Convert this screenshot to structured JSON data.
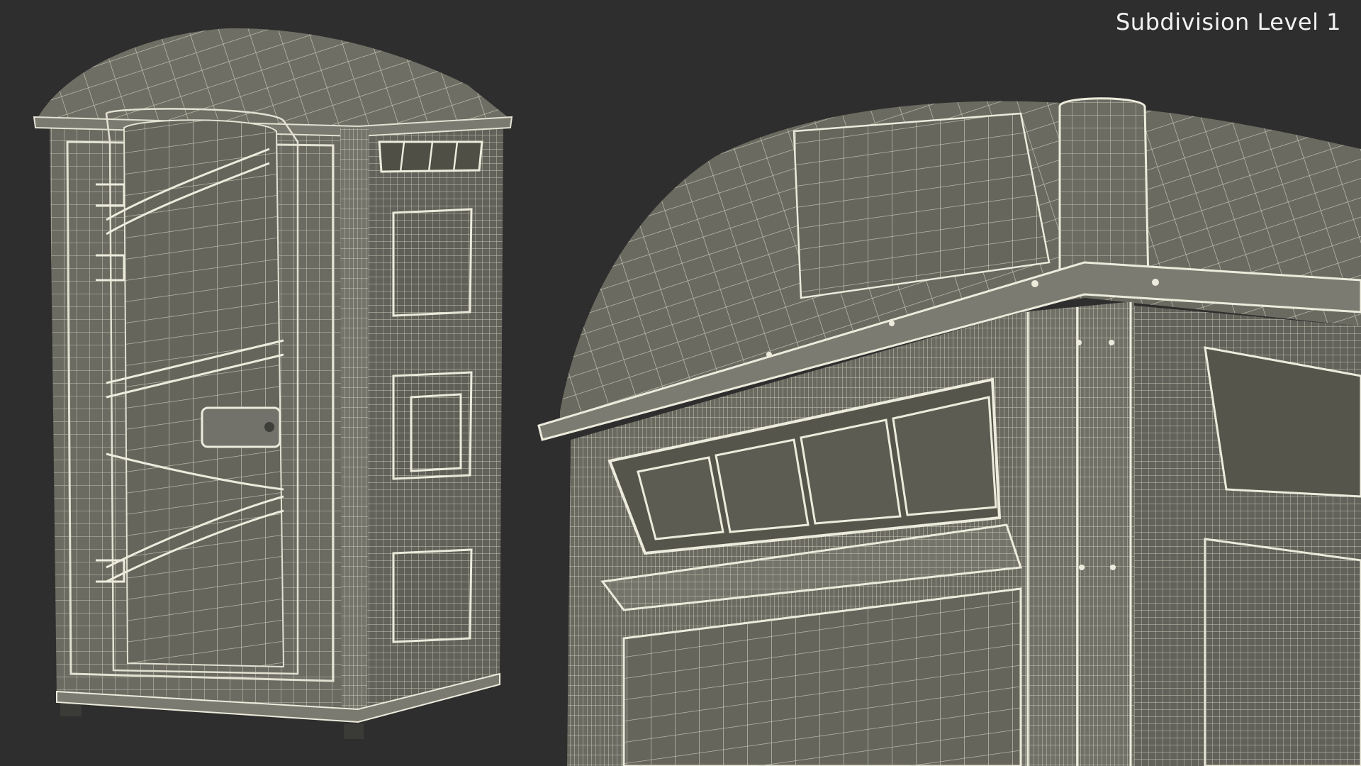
{
  "label": {
    "text": "Subdivision Level 1"
  },
  "scene": {
    "background_color": "#2e2e2e",
    "mesh_fill": "#6b6b62",
    "mesh_shade": "#5a5a52",
    "wire_color": "#d9d8c8",
    "panel_dark": "#545449",
    "label_color": "#f2f2f2"
  },
  "views": [
    {
      "name": "full-view",
      "subject": "portable-toilet-wireframe"
    },
    {
      "name": "closeup-view",
      "subject": "portable-toilet-roof-vent-wireframe"
    }
  ]
}
